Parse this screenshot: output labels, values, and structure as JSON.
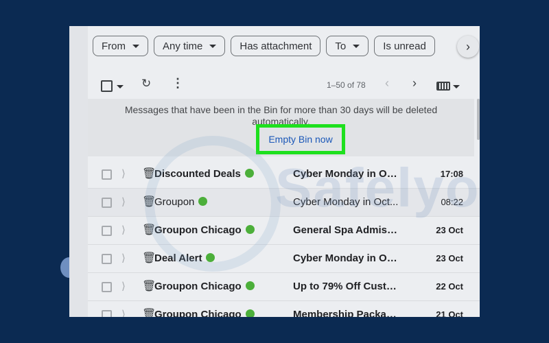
{
  "filters": {
    "chips": [
      {
        "label": "From",
        "dropdown": true
      },
      {
        "label": "Any time",
        "dropdown": true
      },
      {
        "label": "Has attachment",
        "dropdown": false
      },
      {
        "label": "To",
        "dropdown": true
      },
      {
        "label": "Is unread",
        "dropdown": false
      }
    ],
    "next_icon": "chevron-right-icon"
  },
  "toolbar": {
    "pagination": "1–50 of 78",
    "icons": [
      "checkbox-icon",
      "refresh-icon",
      "more-vertical-icon",
      "chevron-left-icon",
      "chevron-right-icon",
      "keyboard-icon"
    ]
  },
  "notice": {
    "text": "Messages that have been in the Bin for more than 30 days will be deleted automatically.",
    "button_label": "Empty Bin now",
    "highlight_color": "#1ee01e"
  },
  "emails": [
    {
      "sender": "Discounted Deals",
      "subject": "Cyber Monday in Oc...",
      "date": "17:08",
      "unread": true
    },
    {
      "sender": "Groupon",
      "subject": "Cyber Monday in Oct...",
      "date": "08:22",
      "unread": false
    },
    {
      "sender": "Groupon Chicago",
      "subject": "General Spa Admissi...",
      "date": "23 Oct",
      "unread": true
    },
    {
      "sender": "Deal Alert",
      "subject": "Cyber Monday in Oc...",
      "date": "23 Oct",
      "unread": true
    },
    {
      "sender": "Groupon Chicago",
      "subject": "Up to 79% Off Custo...",
      "date": "22 Oct",
      "unread": true
    },
    {
      "sender": "Groupon Chicago",
      "subject": "Membership Packag...",
      "date": "21 Oct",
      "unread": true
    }
  ],
  "watermark": "Safelyo",
  "colors": {
    "page_bg": "#0b2a52",
    "link": "#1a57b8",
    "status_dot": "#4caf3a"
  }
}
